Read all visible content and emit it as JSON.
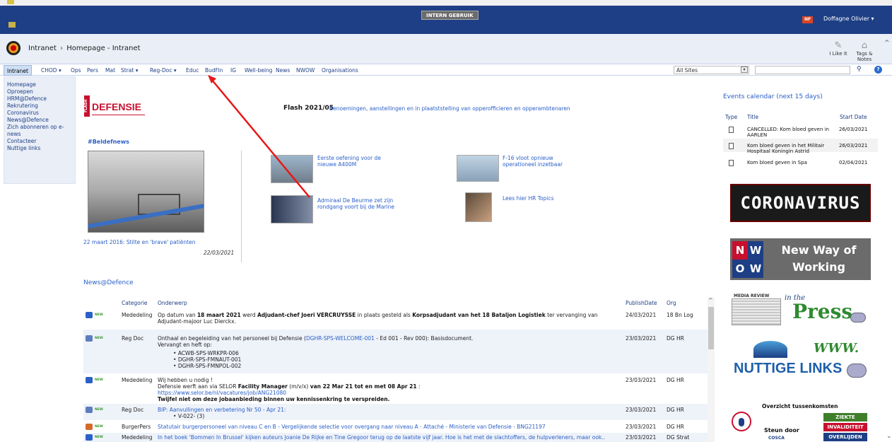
{
  "system": {
    "banner": "INTERN GEBRUIK",
    "user_name": "Doffagne Olivier ▾",
    "nf_badge": "NF"
  },
  "breadcrumb": {
    "root": "Intranet",
    "separator": "›",
    "current": "Homepage - Intranet"
  },
  "ribbon": {
    "like_label": "I Like It",
    "tags_label_1": "Tags &",
    "tags_label_2": "Notes"
  },
  "nav": {
    "items": [
      "Intranet",
      "CHOD ▾",
      "Ops",
      "Pers",
      "Mat",
      "Strat ▾",
      "Reg-Doc ▾",
      "Educ",
      "BudFin",
      "IG",
      "Well-being",
      "News",
      "NWOW",
      "Organisations"
    ],
    "scope": "All Sites",
    "search_placeholder": ""
  },
  "leftnav": {
    "items": [
      "Homepage",
      "Oproepen",
      "HRM@Defence",
      "Rekrutering",
      "Coronavirus",
      "News@Defence",
      "Zich abonneren op e-news",
      "Contacteer",
      "Nuttige links"
    ]
  },
  "logo": {
    "flash": "FLASH",
    "word": "DEFENSIE"
  },
  "flash": {
    "title": "Flash 2021/05",
    "link": "Benoemingen, aanstellingen en in plaatststelling van opperofficieren en opperambtenaren"
  },
  "beldefnews": {
    "heading": "#Beldefnews",
    "caption": "22 maart 2016: Stilte en 'brave' patiënten",
    "date": "22/03/2021"
  },
  "teasers": [
    {
      "line1": "Eerste oefening voor de",
      "line2": "nieuwe A400M"
    },
    {
      "line1": "F-16 vloot opnieuw",
      "line2": "operationeel inzetbaar"
    },
    {
      "line1": "Admiraal De Beurme zet zijn",
      "line2": "rondgang voort bij de Marine"
    },
    {
      "line1": "Lees hier HR Topics",
      "line2": ""
    }
  ],
  "events": {
    "title": "Events calendar (next 15 days)",
    "headers": [
      "Type",
      "Title",
      "Start Date"
    ],
    "rows": [
      {
        "title": "CANCELLED: Kom bloed geven in AARLEN",
        "date": "26/03/2021"
      },
      {
        "title": "Kom bloed geven in het Militair Hospitaal Koningin Astrid",
        "date": "26/03/2021"
      },
      {
        "title": "Kom bloed geven in Spa",
        "date": "02/04/2021"
      }
    ]
  },
  "promos": {
    "corona": "CORONAVIRUS",
    "nwow_box": [
      "N",
      "W",
      "O",
      "W"
    ],
    "nwow_line1": "New Way of",
    "nwow_line2": "Working",
    "press_mr": "MEDIA REVIEW",
    "press_intro": "in the",
    "press_word": "Press",
    "links_www": "WWW.",
    "links_word": "NUTTIGE LINKS",
    "overzicht_title": "Overzicht tussenkomsten",
    "overzicht_pills": [
      "ZIEKTE",
      "INVALIDITEIT",
      "OVERLIJDEN"
    ],
    "overzicht_steun": "Steun door",
    "overzicht_cosca": "COSCA"
  },
  "news": {
    "title": "News@Defence",
    "headers": [
      "Categorie",
      "Onderwerp",
      "PublishDate",
      "Org"
    ],
    "new_label": "NEW",
    "rows": [
      {
        "category": "Mededeling",
        "s1": "Op datum van ",
        "b1": "18 maart 2021",
        "s2": " werd  ",
        "b2": "Adjudant-chef Joeri VERCRUYSSE",
        "s3": " in plaats gesteld als ",
        "b3": "Korpsadjudant van het 18 Bataljon Logistiek",
        "s4": " ter vervanging van",
        "line2": "Adjudant-majoor Luc Dierckx.",
        "date": "24/03/2021",
        "org": "18 Bn Log"
      },
      {
        "category": "Reg Doc",
        "s1": "Onthaal en begeleiding van het personeel bij Defensie (",
        "link": "DGHR-SPS-WELCOME-001",
        "s2": " - Ed 001 - Rev 000): Basisdocument.",
        "line2": "Vervangt en heft op:",
        "bullets": [
          "ACWB-SPS-WRKPR-006",
          "DGHR-SPS-FMNAUT-001",
          "DGHR-SPS-FMNPOL-002"
        ],
        "date": "23/03/2021",
        "org": "DG HR"
      },
      {
        "category": "Mededeling",
        "line1": "Wij hebben u nodig !",
        "s1": "Defensie werft aan via SELOR ",
        "b1": "Facility Manager",
        "s2": " (m/v/x) ",
        "b2": "van 22 Mar 21 tot en met 08 Apr 21",
        "s3": " :",
        "link": "https://www.selor.be/nl/vacatures/job/ANG21080",
        "b3": "Twijfel niet om deze jobaanbieding binnen uw kennissenkring te verspreiden.",
        "date": "23/03/2021",
        "org": "DG HR"
      },
      {
        "category": "Reg Doc",
        "link": "BIP: Aanvullingen en verbetering Nr 50 - Apr 21:",
        "bullets": [
          "V-022- (3)"
        ],
        "date": "23/03/2021",
        "org": "DG HR"
      },
      {
        "category": "BurgerPers",
        "link": "Statutair burgerpersoneel van niveau C en B - Vergelijkende selectie voor overgang naar niveau A - Attaché - Ministerie van Defensie - BNG21197",
        "date": "23/03/2021",
        "org": "DG HR"
      },
      {
        "category": "Mededeling",
        "link": "In het boek 'Bommen In Brussel' kijken auteurs Joanie De Rijke en Tine Gregoor terug op de laatste vijf jaar. Hoe is het met de slachtoffers, de hulpverleners, maar ook..",
        "date": "23/03/2021",
        "org": "DG Strat"
      }
    ]
  },
  "colors": {
    "header_blue": "#1e3f85",
    "link_blue": "#2b60c8",
    "defensie_red": "#c8102e",
    "annotation_red": "#e81818"
  }
}
